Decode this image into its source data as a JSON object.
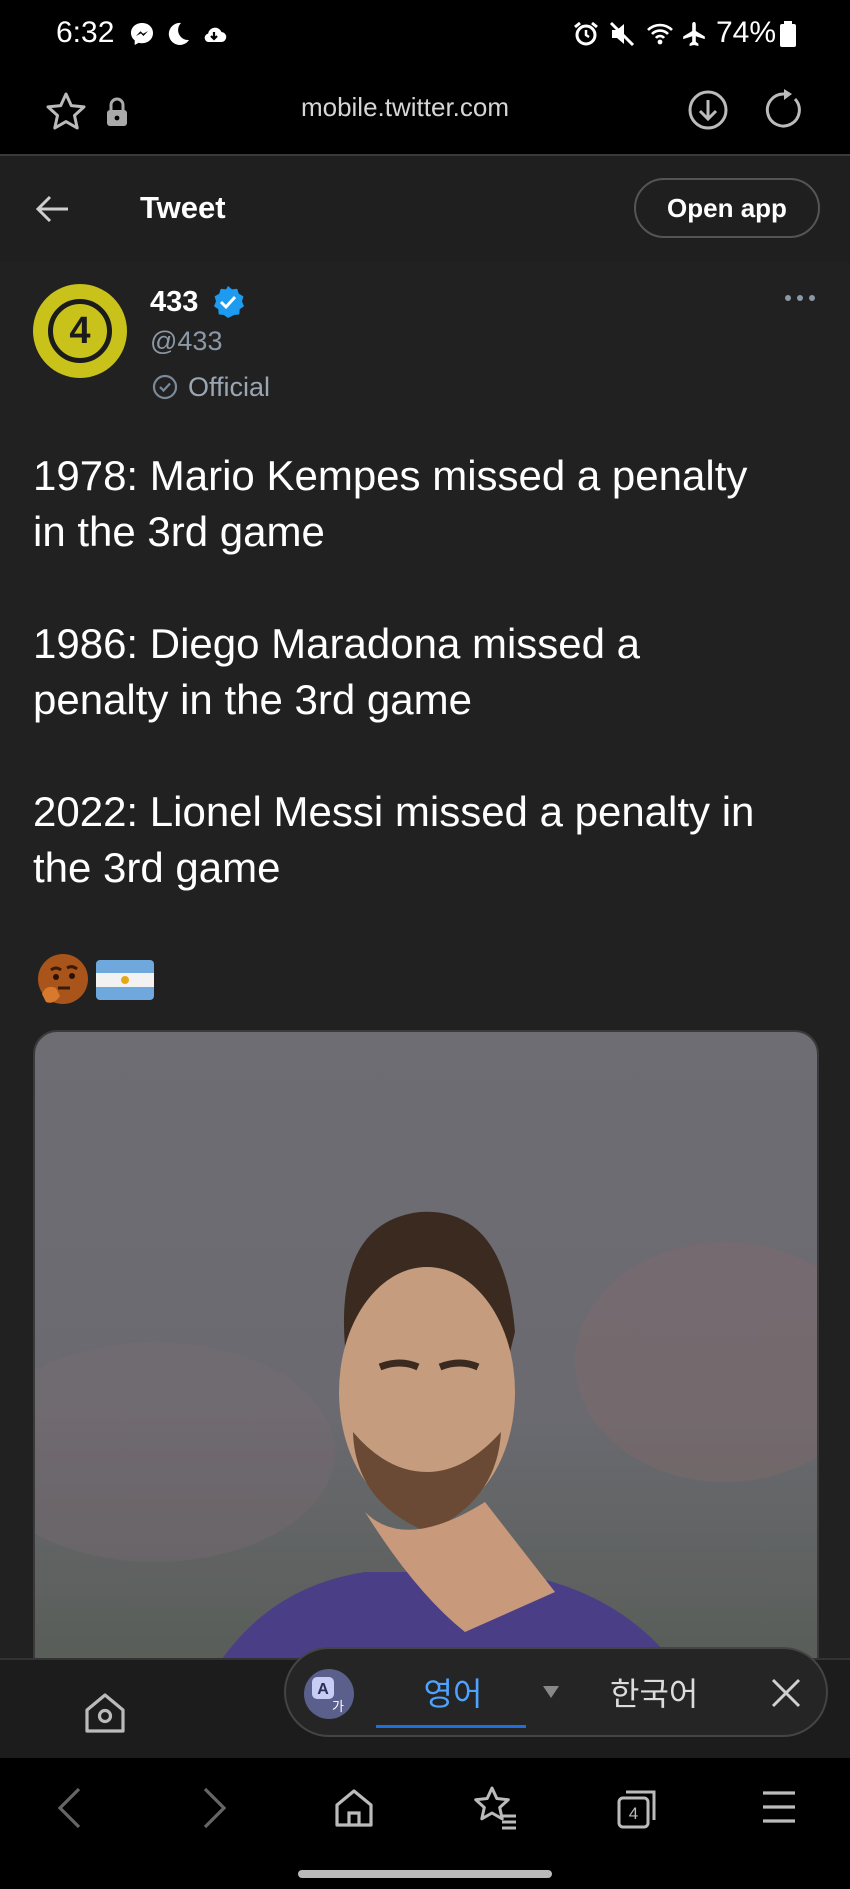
{
  "status_bar": {
    "time": "6:32",
    "battery": "74%",
    "icons": [
      "messenger-icon",
      "moon-icon",
      "cloud-icon",
      "alarm-icon",
      "mute-icon",
      "wifi-icon",
      "airplane-icon",
      "battery-icon"
    ]
  },
  "browser": {
    "url": "mobile.twitter.com"
  },
  "header": {
    "title": "Tweet",
    "open_app": "Open app"
  },
  "tweet": {
    "avatar_text": "4",
    "display_name": "433",
    "handle": "@433",
    "official_label": "Official",
    "lines": [
      "1978: Mario Kempes missed a penalty",
      "in the 3rd game",
      "1986: Diego Maradona missed a",
      "penalty in the 3rd game",
      "2022: Lionel Messi missed a penalty in",
      "the 3rd game"
    ],
    "emojis": [
      "thinking-face-icon",
      "argentina-flag-icon"
    ]
  },
  "translate": {
    "source_lang": "영어",
    "target_lang": "한국어"
  },
  "colors": {
    "tweet_bg": "#212121",
    "accent_blue": "#1d9bf0",
    "avatar_yellow": "#c8c21a"
  }
}
